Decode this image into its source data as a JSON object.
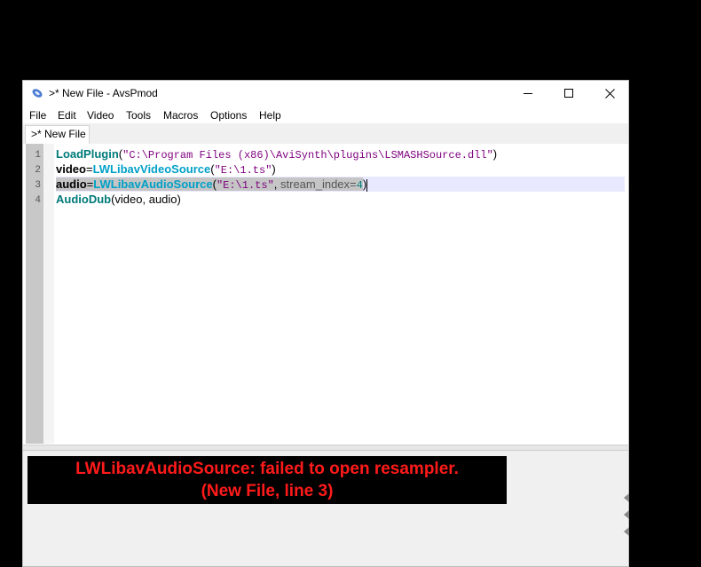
{
  "window": {
    "title": ">* New File - AvsPmod"
  },
  "menu": [
    "File",
    "Edit",
    "Video",
    "Tools",
    "Macros",
    "Options",
    "Help"
  ],
  "tab": {
    "label": ">* New File"
  },
  "editor": {
    "line_numbers": [
      "1",
      "2",
      "3",
      "4"
    ],
    "lines": [
      {
        "kw": "LoadPlugin",
        "open": "(",
        "str": "\"C:\\Program Files (x86)\\AviSynth\\plugins\\LSMASHSource.dll\"",
        "close": ")"
      },
      {
        "var": "video",
        "eq": "=",
        "fn": "LWLibavVideoSource",
        "open": "(",
        "str": "\"E:\\1.ts\"",
        "close": ")"
      },
      {
        "var": "audio",
        "eq": "=",
        "fn": "LWLibavAudioSource",
        "open": "(",
        "str": "\"E:\\1.ts\"",
        "comma": ",",
        "arg": " stream_index=",
        "num": "4",
        "close": ")"
      },
      {
        "kw": "AudioDub",
        "text": "(video, audio)"
      }
    ],
    "current_line": 3
  },
  "error": {
    "line1": "LWLibavAudioSource: failed to open resampler.",
    "line2": "(New File, line 3)",
    "color": "#ff1a1a"
  },
  "colors": {
    "keyword": "#007a7a",
    "function": "#00a0c8",
    "string": "#7f007f"
  }
}
